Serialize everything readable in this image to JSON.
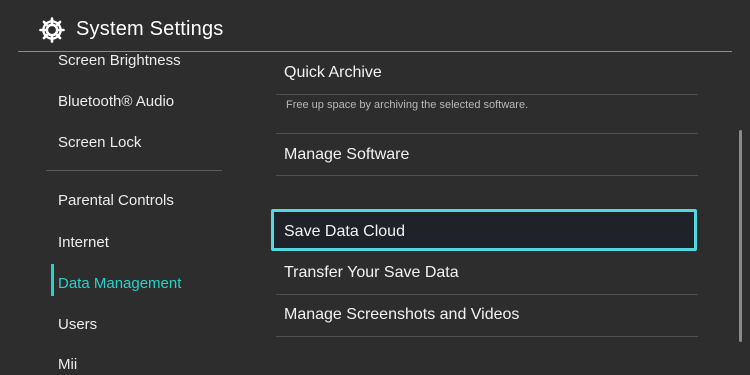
{
  "header": {
    "title": "System Settings",
    "icon": "gear-icon"
  },
  "sidebar": {
    "items": [
      {
        "label": "Screen Brightness"
      },
      {
        "label": "Bluetooth® Audio"
      },
      {
        "label": "Screen Lock"
      },
      {
        "label": "Parental Controls"
      },
      {
        "label": "Internet"
      },
      {
        "label": "Data Management",
        "active": true
      },
      {
        "label": "Users"
      },
      {
        "label": "Mii"
      }
    ]
  },
  "content": {
    "rows": [
      {
        "label": "Quick Archive",
        "description": "Free up space by archiving the selected software."
      },
      {
        "label": "Manage Software"
      },
      {
        "label": "Save Data Cloud",
        "selected": true
      },
      {
        "label": "Transfer Your Save Data"
      },
      {
        "label": "Manage Screenshots and Videos"
      }
    ]
  },
  "colors": {
    "background": "#2d2d2d",
    "accent": "#25d4c8",
    "selection_border": "#54d8e0"
  }
}
